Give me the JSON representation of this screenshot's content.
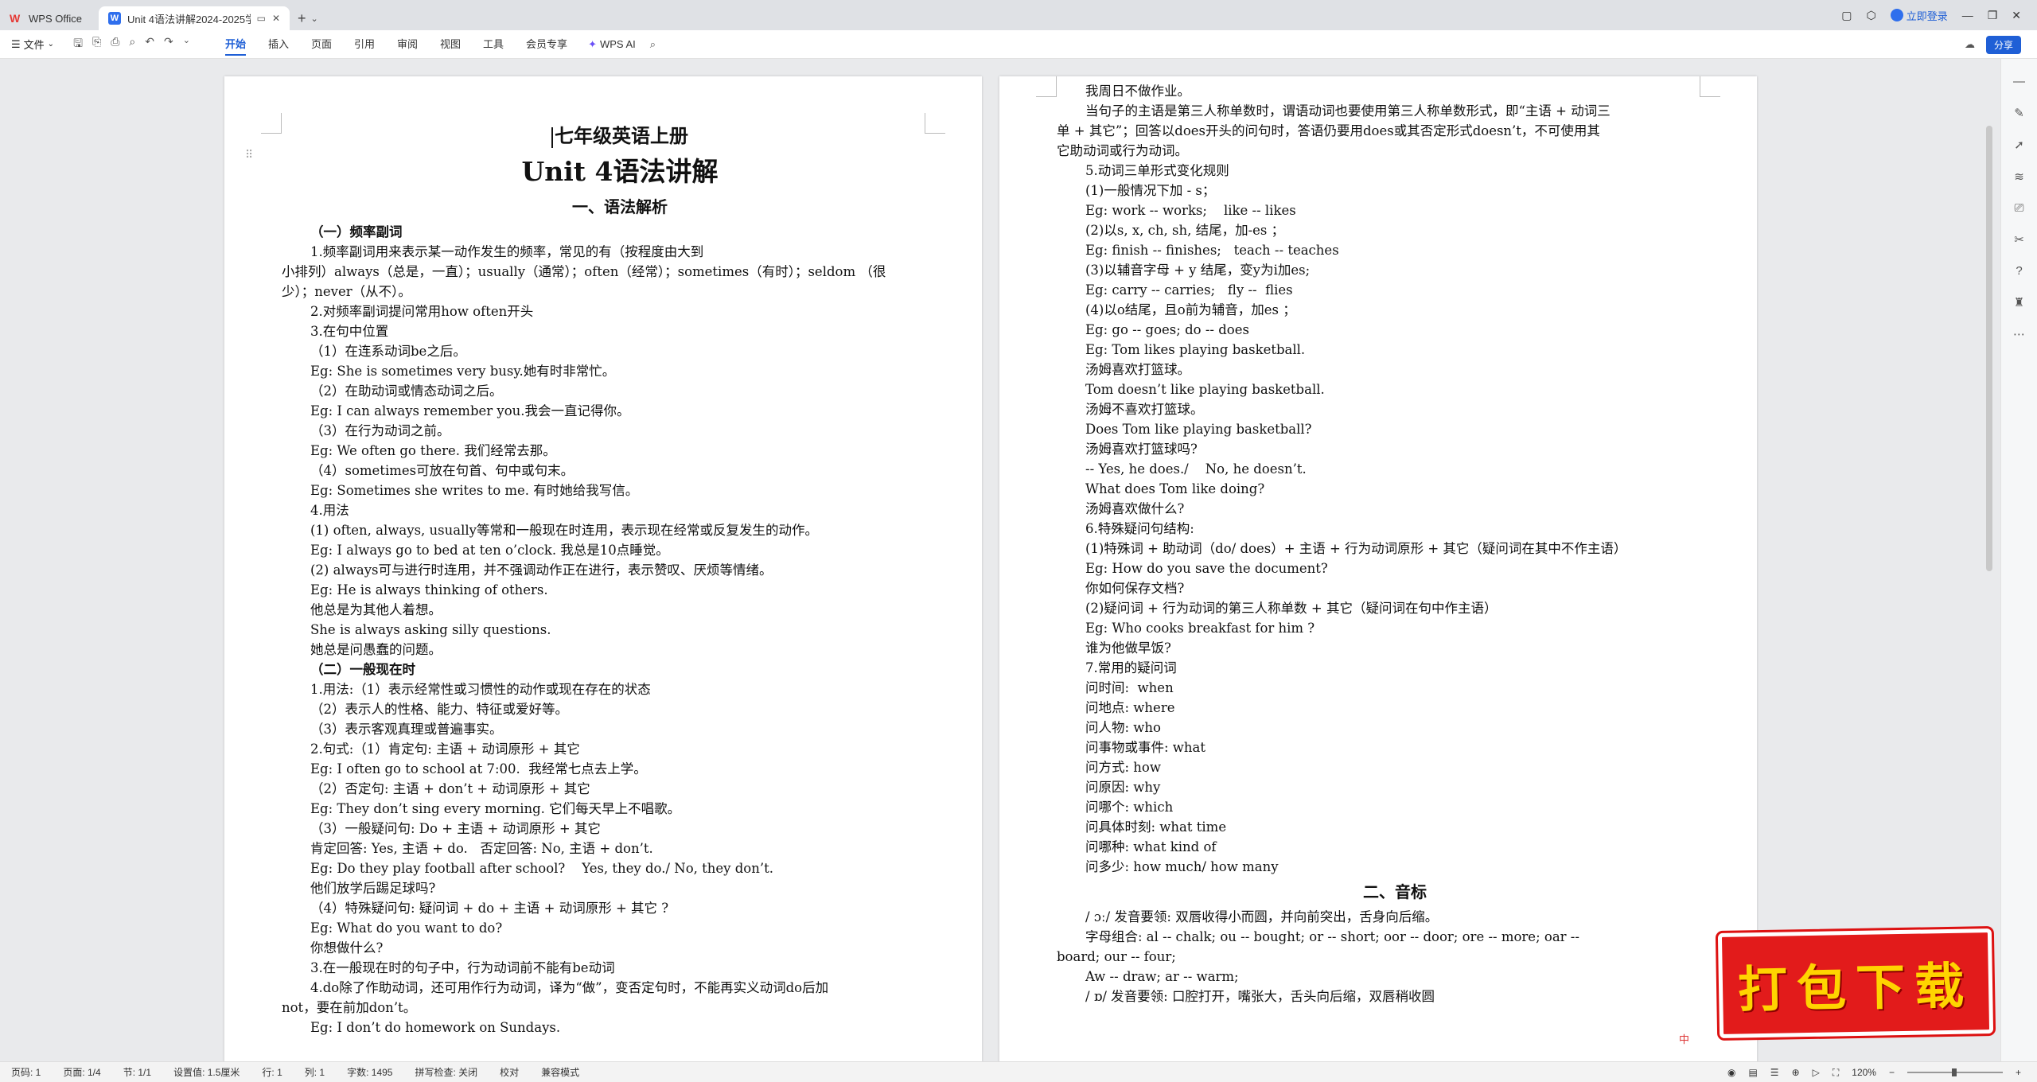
{
  "titlebar": {
    "home_tab": "WPS Office",
    "doc_tab": "Unit 4语法讲解2024-2025学",
    "login": "立即登录"
  },
  "menubar": {
    "file": "文件",
    "items": [
      "开始",
      "插入",
      "页面",
      "引用",
      "审阅",
      "视图",
      "工具",
      "会员专享"
    ],
    "active": "开始",
    "wps_ai": "WPS AI",
    "share": "分享"
  },
  "page1": {
    "title": "七年级英语上册",
    "unit": "Unit 4语法讲解",
    "section": "一、语法解析",
    "lines": [
      {
        "t": "（一）频率副词",
        "s": "sub"
      },
      {
        "t": "1.频率副词用来表示某一动作发生的频率，常见的有（按程度由大到",
        "s": "ind"
      },
      {
        "t": "小排列）always（总是，一直）；usually（通常）；often（经常）；sometimes（有时）；seldom （很",
        "s": ""
      },
      {
        "t": "少）；never（从不）。",
        "s": ""
      },
      {
        "t": "2.对频率副词提问常用how often开头",
        "s": "ind"
      },
      {
        "t": "3.在句中位置",
        "s": "ind"
      },
      {
        "t": "（1）在连系动词be之后。",
        "s": "ind"
      },
      {
        "t": "Eg: She is sometimes very busy.她有时非常忙。",
        "s": "ind"
      },
      {
        "t": "（2）在助动词或情态动词之后。",
        "s": "ind"
      },
      {
        "t": "Eg: I can always remember you.我会一直记得你。",
        "s": "ind"
      },
      {
        "t": "（3）在行为动词之前。",
        "s": "ind"
      },
      {
        "t": "Eg: We often go there. 我们经常去那。",
        "s": "ind"
      },
      {
        "t": "（4）sometimes可放在句首、句中或句末。",
        "s": "ind"
      },
      {
        "t": "Eg: Sometimes she writes to me. 有时她给我写信。",
        "s": "ind"
      },
      {
        "t": "4.用法",
        "s": "ind"
      },
      {
        "t": "(1) often, always, usually等常和一般现在时连用，表示现在经常或反复发生的动作。",
        "s": "ind"
      },
      {
        "t": "Eg: I always go to bed at ten o’clock. 我总是10点睡觉。",
        "s": "ind"
      },
      {
        "t": "(2) always可与进行时连用，并不强调动作正在进行，表示赞叹、厌烦等情绪。",
        "s": "ind"
      },
      {
        "t": "Eg: He is always thinking of others.",
        "s": "ind"
      },
      {
        "t": "他总是为其他人着想。",
        "s": "ind"
      },
      {
        "t": "She is always asking silly questions.",
        "s": "ind"
      },
      {
        "t": "她总是问愚蠢的问题。",
        "s": "ind"
      },
      {
        "t": "（二）一般现在时",
        "s": "sub"
      },
      {
        "t": "1.用法:（1）表示经常性或习惯性的动作或现在存在的状态",
        "s": "ind"
      },
      {
        "t": "（2）表示人的性格、能力、特征或爱好等。",
        "s": "ind"
      },
      {
        "t": "（3）表示客观真理或普遍事实。",
        "s": "ind"
      },
      {
        "t": "2.句式:（1）肯定句: 主语 + 动词原形 + 其它",
        "s": "ind"
      },
      {
        "t": "Eg: I often go to school at 7:00.  我经常七点去上学。",
        "s": "ind"
      },
      {
        "t": "（2）否定句: 主语 + don’t + 动词原形 + 其它",
        "s": "ind"
      },
      {
        "t": "Eg: They don’t sing every morning. 它们每天早上不唱歌。",
        "s": "ind"
      },
      {
        "t": "（3）一般疑问句: Do + 主语 + 动词原形 + 其它",
        "s": "ind"
      },
      {
        "t": "肯定回答: Yes, 主语 + do.   否定回答: No, 主语 + don’t.",
        "s": "ind"
      },
      {
        "t": "Eg: Do they play football after school?    Yes, they do./ No, they don’t.",
        "s": "ind"
      },
      {
        "t": "他们放学后踢足球吗?",
        "s": "ind"
      },
      {
        "t": "（4）特殊疑问句: 疑问词 + do + 主语 + 动词原形 + 其它 ?",
        "s": "ind"
      },
      {
        "t": "Eg: What do you want to do?",
        "s": "ind"
      },
      {
        "t": "你想做什么?",
        "s": "ind"
      },
      {
        "t": "3.在一般现在时的句子中，行为动词前不能有be动词",
        "s": "ind"
      },
      {
        "t": "4.do除了作助动词，还可用作行为动词，译为“做”，变否定句时，不能再实义动词do后加",
        "s": "ind"
      },
      {
        "t": "not，要在前加don’t。",
        "s": ""
      },
      {
        "t": "Eg: I don’t do homework on Sundays.",
        "s": "ind"
      }
    ]
  },
  "page2": {
    "lines": [
      {
        "t": "我周日不做作业。",
        "s": "ind"
      },
      {
        "t": "当句子的主语是第三人称单数时，谓语动词也要使用第三人称单数形式，即“主语 + 动词三",
        "s": "ind"
      },
      {
        "t": "单 + 其它”；回答以does开头的问句时，答语仍要用does或其否定形式doesn’t，不可使用其",
        "s": ""
      },
      {
        "t": "它助动词或行为动词。",
        "s": ""
      },
      {
        "t": "5.动词三单形式变化规则",
        "s": "ind"
      },
      {
        "t": "(1)一般情况下加 - s；",
        "s": "ind"
      },
      {
        "t": "Eg: work -- works;    like -- likes",
        "s": "ind"
      },
      {
        "t": "(2)以s, x, ch, sh, 结尾，加-es ；",
        "s": "ind"
      },
      {
        "t": "Eg: finish -- finishes;   teach -- teaches",
        "s": "ind"
      },
      {
        "t": "(3)以辅音字母 + y 结尾，变y为i加es;",
        "s": "ind"
      },
      {
        "t": "Eg: carry -- carries;   fly --  flies",
        "s": "ind"
      },
      {
        "t": "(4)以o结尾，且o前为辅音，加es ；",
        "s": "ind"
      },
      {
        "t": "Eg: go -- goes; do -- does",
        "s": "ind"
      },
      {
        "t": "Eg: Tom likes playing basketball.",
        "s": "ind"
      },
      {
        "t": "汤姆喜欢打篮球。",
        "s": "ind"
      },
      {
        "t": "Tom doesn’t like playing basketball.",
        "s": "ind"
      },
      {
        "t": "汤姆不喜欢打篮球。",
        "s": "ind"
      },
      {
        "t": "Does Tom like playing basketball?",
        "s": "ind"
      },
      {
        "t": "汤姆喜欢打篮球吗?",
        "s": "ind"
      },
      {
        "t": "-- Yes, he does./    No, he doesn’t.",
        "s": "ind"
      },
      {
        "t": "What does Tom like doing?",
        "s": "ind"
      },
      {
        "t": "汤姆喜欢做什么?",
        "s": "ind"
      },
      {
        "t": "6.特殊疑问句结构:",
        "s": "ind"
      },
      {
        "t": "(1)特殊词 + 助动词（do/ does）+ 主语 + 行为动词原形 + 其它（疑问词在其中不作主语）",
        "s": "ind"
      },
      {
        "t": "Eg: How do you save the document?",
        "s": "ind"
      },
      {
        "t": "你如何保存文档?",
        "s": "ind"
      },
      {
        "t": "(2)疑问词 + 行为动词的第三人称单数 + 其它（疑问词在句中作主语）",
        "s": "ind"
      },
      {
        "t": "Eg: Who cooks breakfast for him ?",
        "s": "ind"
      },
      {
        "t": "谁为他做早饭?",
        "s": "ind"
      },
      {
        "t": "7.常用的疑问词",
        "s": "ind"
      },
      {
        "t": "问时间:  when",
        "s": "ind"
      },
      {
        "t": "问地点: where",
        "s": "ind"
      },
      {
        "t": "问人物: who",
        "s": "ind"
      },
      {
        "t": "问事物或事件: what",
        "s": "ind"
      },
      {
        "t": "问方式: how",
        "s": "ind"
      },
      {
        "t": "问原因: why",
        "s": "ind"
      },
      {
        "t": "问哪个: which",
        "s": "ind"
      },
      {
        "t": "问具体时刻: what time",
        "s": "ind"
      },
      {
        "t": "问哪种: what kind of",
        "s": "ind"
      },
      {
        "t": "问多少: how much/ how many",
        "s": "ind"
      },
      {
        "t": "二、音标",
        "s": "sec"
      },
      {
        "t": "/ ɔː/ 发音要领: 双唇收得小而圆，并向前突出，舌身向后缩。",
        "s": "ind"
      },
      {
        "t": "字母组合: al -- chalk; ou -- bought; or -- short; oor -- door; ore -- more; oar --",
        "s": "ind"
      },
      {
        "t": "board; our -- four;",
        "s": ""
      },
      {
        "t": "Aw -- draw; ar -- warm;",
        "s": "ind"
      },
      {
        "t": "/ ɒ/ 发音要领: 口腔打开，嘴张大，舌头向后缩，双唇稍收圆",
        "s": "ind"
      }
    ]
  },
  "statusbar": {
    "page_no": "页码: 1",
    "page": "页面: 1/4",
    "section": "节: 1/1",
    "setting": "设置值: 1.5厘米",
    "row": "行: 1",
    "col": "列: 1",
    "words": "字数: 1495",
    "spell": "拼写检查: 关闭",
    "proof": "校对",
    "compat": "兼容模式",
    "zoom": "120%"
  },
  "banner": {
    "text": "打包下载"
  },
  "watermark": "中"
}
